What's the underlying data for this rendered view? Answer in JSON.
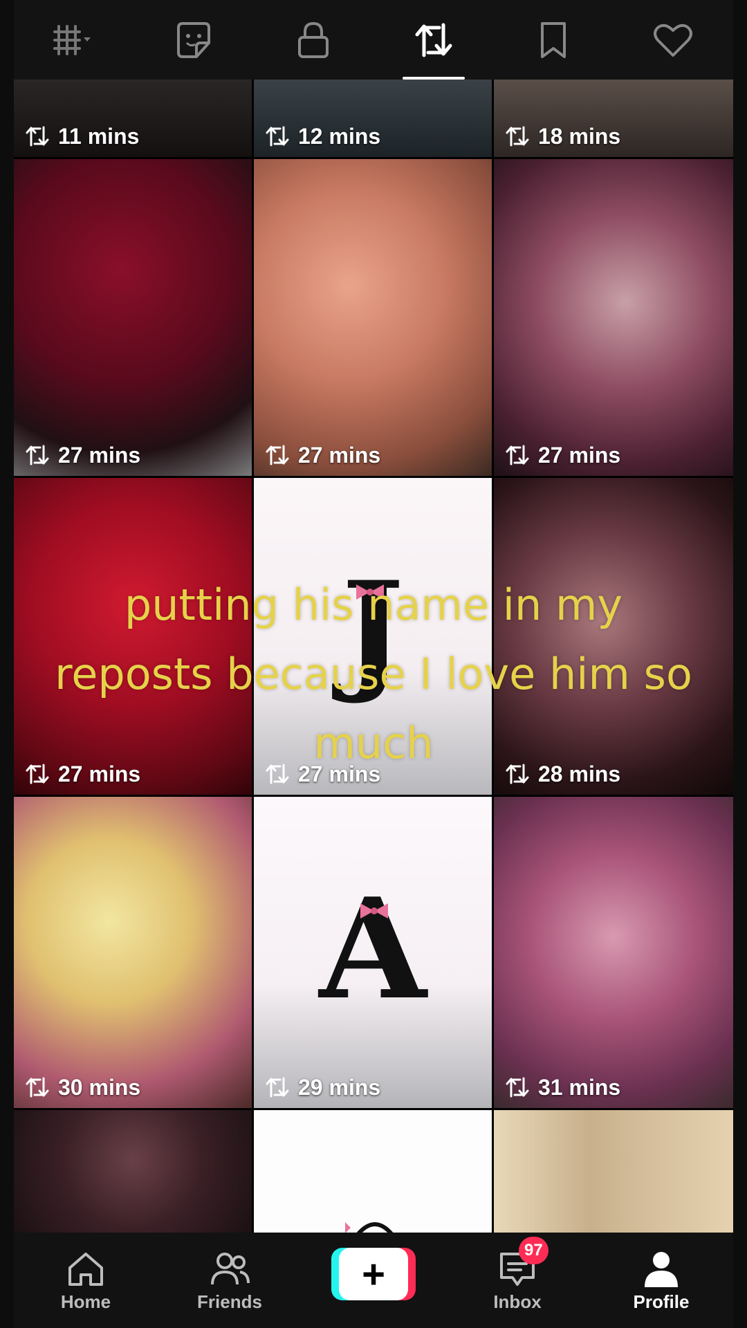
{
  "top_tabs": [
    {
      "name": "grid-tab",
      "icon": "grid-icon",
      "active": false
    },
    {
      "name": "sticker-tab",
      "icon": "sticker-icon",
      "active": false
    },
    {
      "name": "private-tab",
      "icon": "lock-icon",
      "active": false
    },
    {
      "name": "reposts-tab",
      "icon": "repost-icon",
      "active": true
    },
    {
      "name": "favorites-tab",
      "icon": "bookmark-icon",
      "active": false
    },
    {
      "name": "liked-tab",
      "icon": "heart-icon",
      "active": false
    }
  ],
  "grid": {
    "tiles": [
      {
        "time": "11 mins",
        "image": "crowd"
      },
      {
        "time": "12 mins",
        "image": "dark-landscape"
      },
      {
        "time": "18 mins",
        "image": "crowd"
      },
      {
        "time": "27 mins",
        "image": "red-roses-bouquet"
      },
      {
        "time": "27 mins",
        "image": "peach-lilies"
      },
      {
        "time": "27 mins",
        "image": "pink-lilies"
      },
      {
        "time": "27 mins",
        "image": "red-roses"
      },
      {
        "time": "27 mins",
        "image": "letter-J",
        "letter": "J"
      },
      {
        "time": "28 mins",
        "image": "pink-lilies-dark"
      },
      {
        "time": "30 mins",
        "image": "yellow-lilies"
      },
      {
        "time": "29 mins",
        "image": "letter-A",
        "letter": "A"
      },
      {
        "time": "31 mins",
        "image": "stargazer-lilies"
      },
      {
        "time": "",
        "image": "dark-lilies"
      },
      {
        "time": "",
        "image": "white-letter"
      },
      {
        "time": "",
        "image": "window-lilies"
      }
    ]
  },
  "caption": {
    "line1": "putting his name in my",
    "line2": "reposts because I love him so",
    "line3": "much"
  },
  "bottom_nav": {
    "home": "Home",
    "friends": "Friends",
    "create": "+",
    "inbox": "Inbox",
    "inbox_badge": "97",
    "profile": "Profile"
  },
  "colors": {
    "caption": "#e6d24a",
    "badge": "#fe2c55",
    "create_cyan": "#25f4ee",
    "create_red": "#fe2c55"
  }
}
